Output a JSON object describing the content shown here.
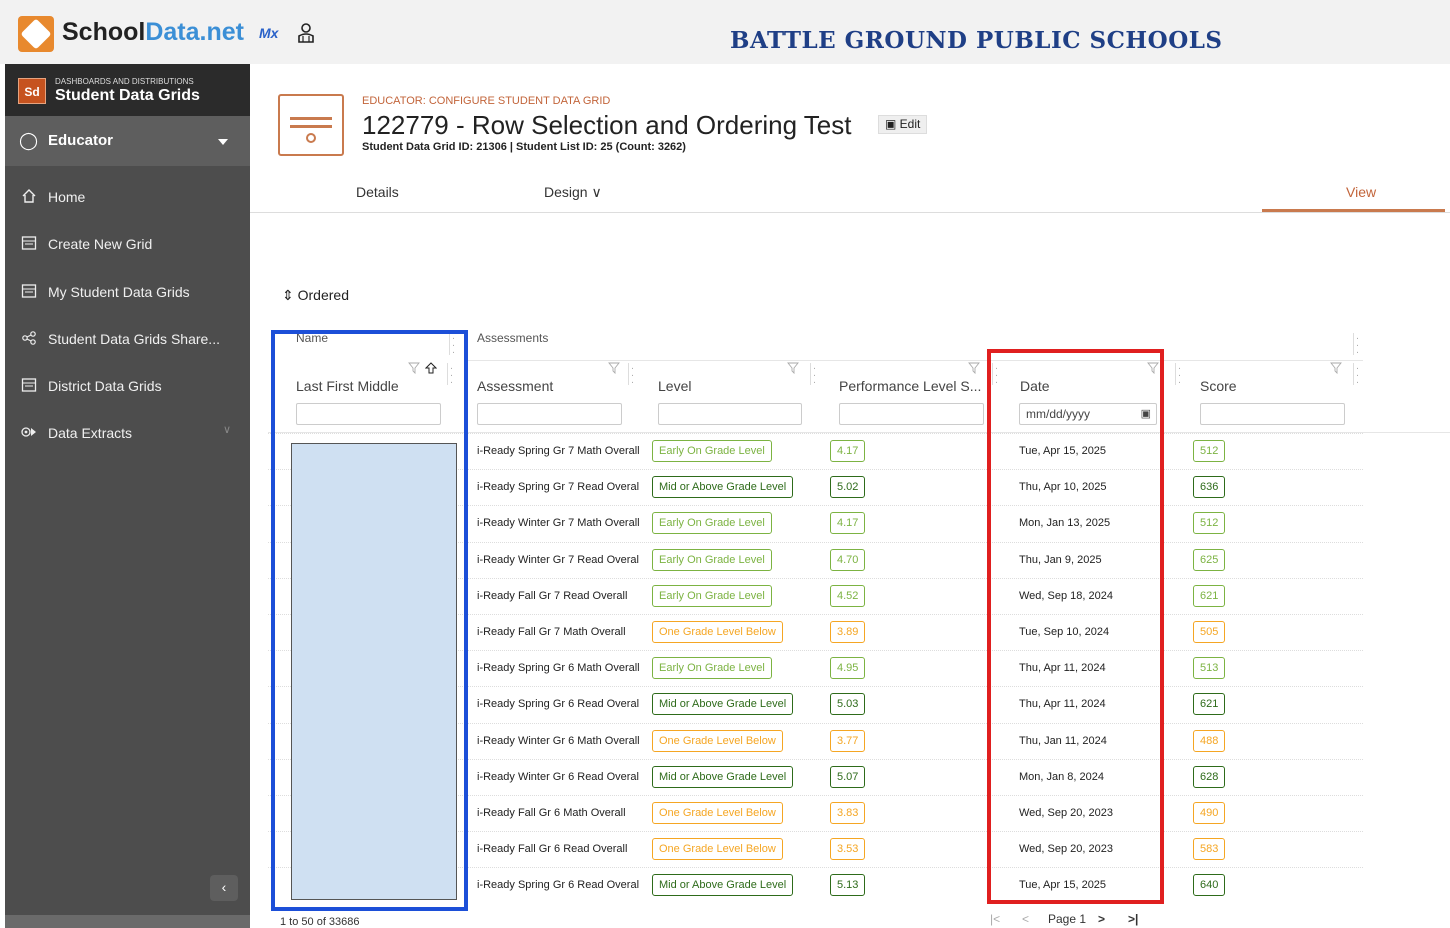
{
  "header": {
    "logo_text_a": "School",
    "logo_text_b": "Data.net",
    "mx_label": "Mx",
    "district": "BATTLE GROUND PUBLIC SCHOOLS"
  },
  "sidebar": {
    "badge": "Sd",
    "section_small": "DASHBOARDS AND DISTRIBUTIONS",
    "section_title": "Student Data Grids",
    "role": "Educator",
    "items": [
      {
        "label": "Home",
        "icon": "home-icon"
      },
      {
        "label": "Create New Grid",
        "icon": "grid-icon"
      },
      {
        "label": "My Student Data Grids",
        "icon": "grid-icon"
      },
      {
        "label": "Student Data Grids Share...",
        "icon": "share-icon"
      },
      {
        "label": "District Data Grids",
        "icon": "grid-icon"
      },
      {
        "label": "Data Extracts",
        "icon": "extract-icon"
      }
    ],
    "collapse_label": "‹"
  },
  "page": {
    "breadcrumb": "EDUCATOR: CONFIGURE STUDENT DATA GRID",
    "title": "122779 - Row Selection and Ordering Test",
    "edit_label": "Edit",
    "subtitle": "Student Data Grid ID: 21306 | Student List ID: 25 (Count: 3262)",
    "tabs": {
      "details": "Details",
      "design": "Design",
      "view": "View"
    },
    "ordered_label": "Ordered"
  },
  "grid": {
    "group_headers": {
      "name": "Name",
      "assessments": "Assessments"
    },
    "columns": {
      "name": "Last First Middle",
      "assessment": "Assessment",
      "level": "Level",
      "performance": "Performance Level S...",
      "date": "Date",
      "score": "Score"
    },
    "date_placeholder": "mm/dd/yyyy",
    "rows": [
      {
        "assessment": "i-Ready Spring Gr 7 Math Overall",
        "level": "Early On Grade Level",
        "perf": "4.17",
        "date": "Tue, Apr 15, 2025",
        "score": "512"
      },
      {
        "assessment": "i-Ready Spring Gr 7 Read Overall",
        "level": "Mid or Above Grade Level",
        "perf": "5.02",
        "date": "Thu, Apr 10, 2025",
        "score": "636"
      },
      {
        "assessment": "i-Ready Winter Gr 7 Math Overall",
        "level": "Early On Grade Level",
        "perf": "4.17",
        "date": "Mon, Jan 13, 2025",
        "score": "512"
      },
      {
        "assessment": "i-Ready Winter Gr 7 Read Overall",
        "level": "Early On Grade Level",
        "perf": "4.70",
        "date": "Thu, Jan 9, 2025",
        "score": "625"
      },
      {
        "assessment": "i-Ready Fall Gr 7 Read Overall",
        "level": "Early On Grade Level",
        "perf": "4.52",
        "date": "Wed, Sep 18, 2024",
        "score": "621"
      },
      {
        "assessment": "i-Ready Fall Gr 7 Math Overall",
        "level": "One Grade Level Below",
        "perf": "3.89",
        "date": "Tue, Sep 10, 2024",
        "score": "505"
      },
      {
        "assessment": "i-Ready Spring Gr 6 Math Overall",
        "level": "Early On Grade Level",
        "perf": "4.95",
        "date": "Thu, Apr 11, 2024",
        "score": "513"
      },
      {
        "assessment": "i-Ready Spring Gr 6 Read Overall",
        "level": "Mid or Above Grade Level",
        "perf": "5.03",
        "date": "Thu, Apr 11, 2024",
        "score": "621"
      },
      {
        "assessment": "i-Ready Winter Gr 6 Math Overall",
        "level": "One Grade Level Below",
        "perf": "3.77",
        "date": "Thu, Jan 11, 2024",
        "score": "488"
      },
      {
        "assessment": "i-Ready Winter Gr 6 Read Overall",
        "level": "Mid or Above Grade Level",
        "perf": "5.07",
        "date": "Mon, Jan 8, 2024",
        "score": "628"
      },
      {
        "assessment": "i-Ready Fall Gr 6 Math Overall",
        "level": "One Grade Level Below",
        "perf": "3.83",
        "date": "Wed, Sep 20, 2023",
        "score": "490"
      },
      {
        "assessment": "i-Ready Fall Gr 6 Read Overall",
        "level": "One Grade Level Below",
        "perf": "3.53",
        "date": "Wed, Sep 20, 2023",
        "score": "583"
      },
      {
        "assessment": "i-Ready Spring Gr 6 Read Overall",
        "level": "Mid or Above Grade Level",
        "perf": "5.13",
        "date": "Tue, Apr 15, 2025",
        "score": "640"
      }
    ],
    "level_colors": {
      "Early On Grade Level": "#7cb342",
      "Mid or Above Grade Level": "#2e6b1a",
      "One Grade Level Below": "#f5a623"
    }
  },
  "footer": {
    "count": "1 to 50 of 33686",
    "first": "|<",
    "prev": "<",
    "page": "Page 1",
    "next": ">",
    "last": ">|"
  },
  "colors": {
    "accent": "#c97a4e",
    "selection_box": "#1c4fd8",
    "highlight_box": "#e01f1f"
  }
}
